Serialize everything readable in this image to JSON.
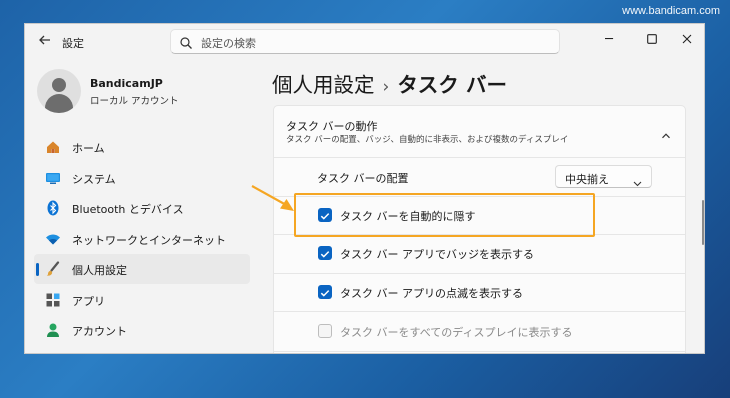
{
  "watermark": "www.bandicam.com",
  "window": {
    "app_title": "設定",
    "search_placeholder": "設定の検索",
    "controls": {
      "minimize": "─",
      "maximize": "☐",
      "close": "✕"
    }
  },
  "profile": {
    "name": "BandicamJP",
    "type": "ローカル アカウント"
  },
  "nav": {
    "items": [
      {
        "label": "ホーム",
        "icon": "home-icon"
      },
      {
        "label": "システム",
        "icon": "system-icon"
      },
      {
        "label": "Bluetooth とデバイス",
        "icon": "bluetooth-icon"
      },
      {
        "label": "ネットワークとインターネット",
        "icon": "wifi-icon"
      },
      {
        "label": "個人用設定",
        "icon": "brush-icon",
        "active": true
      },
      {
        "label": "アプリ",
        "icon": "apps-icon"
      },
      {
        "label": "アカウント",
        "icon": "account-icon"
      }
    ]
  },
  "page": {
    "breadcrumb_parent": "個人用設定",
    "breadcrumb_sep": "›",
    "breadcrumb_current": "タスク バー"
  },
  "section": {
    "title": "タスク バーの動作",
    "description": "タスク バーの配置、バッジ、自動的に非表示、および複数のディスプレイ",
    "alignment_label": "タスク バーの配置",
    "alignment_value": "中央揃え",
    "options": [
      {
        "label": "タスク バーを自動的に隠す",
        "checked": true,
        "disabled": false
      },
      {
        "label": "タスク バー アプリでバッジを表示する",
        "checked": true,
        "disabled": false
      },
      {
        "label": "タスク バー アプリの点滅を表示する",
        "checked": true,
        "disabled": false
      },
      {
        "label": "タスク バーをすべてのディスプレイに表示する",
        "checked": false,
        "disabled": true
      }
    ]
  },
  "colors": {
    "accent": "#0a64c2",
    "highlight": "#f5a623"
  }
}
